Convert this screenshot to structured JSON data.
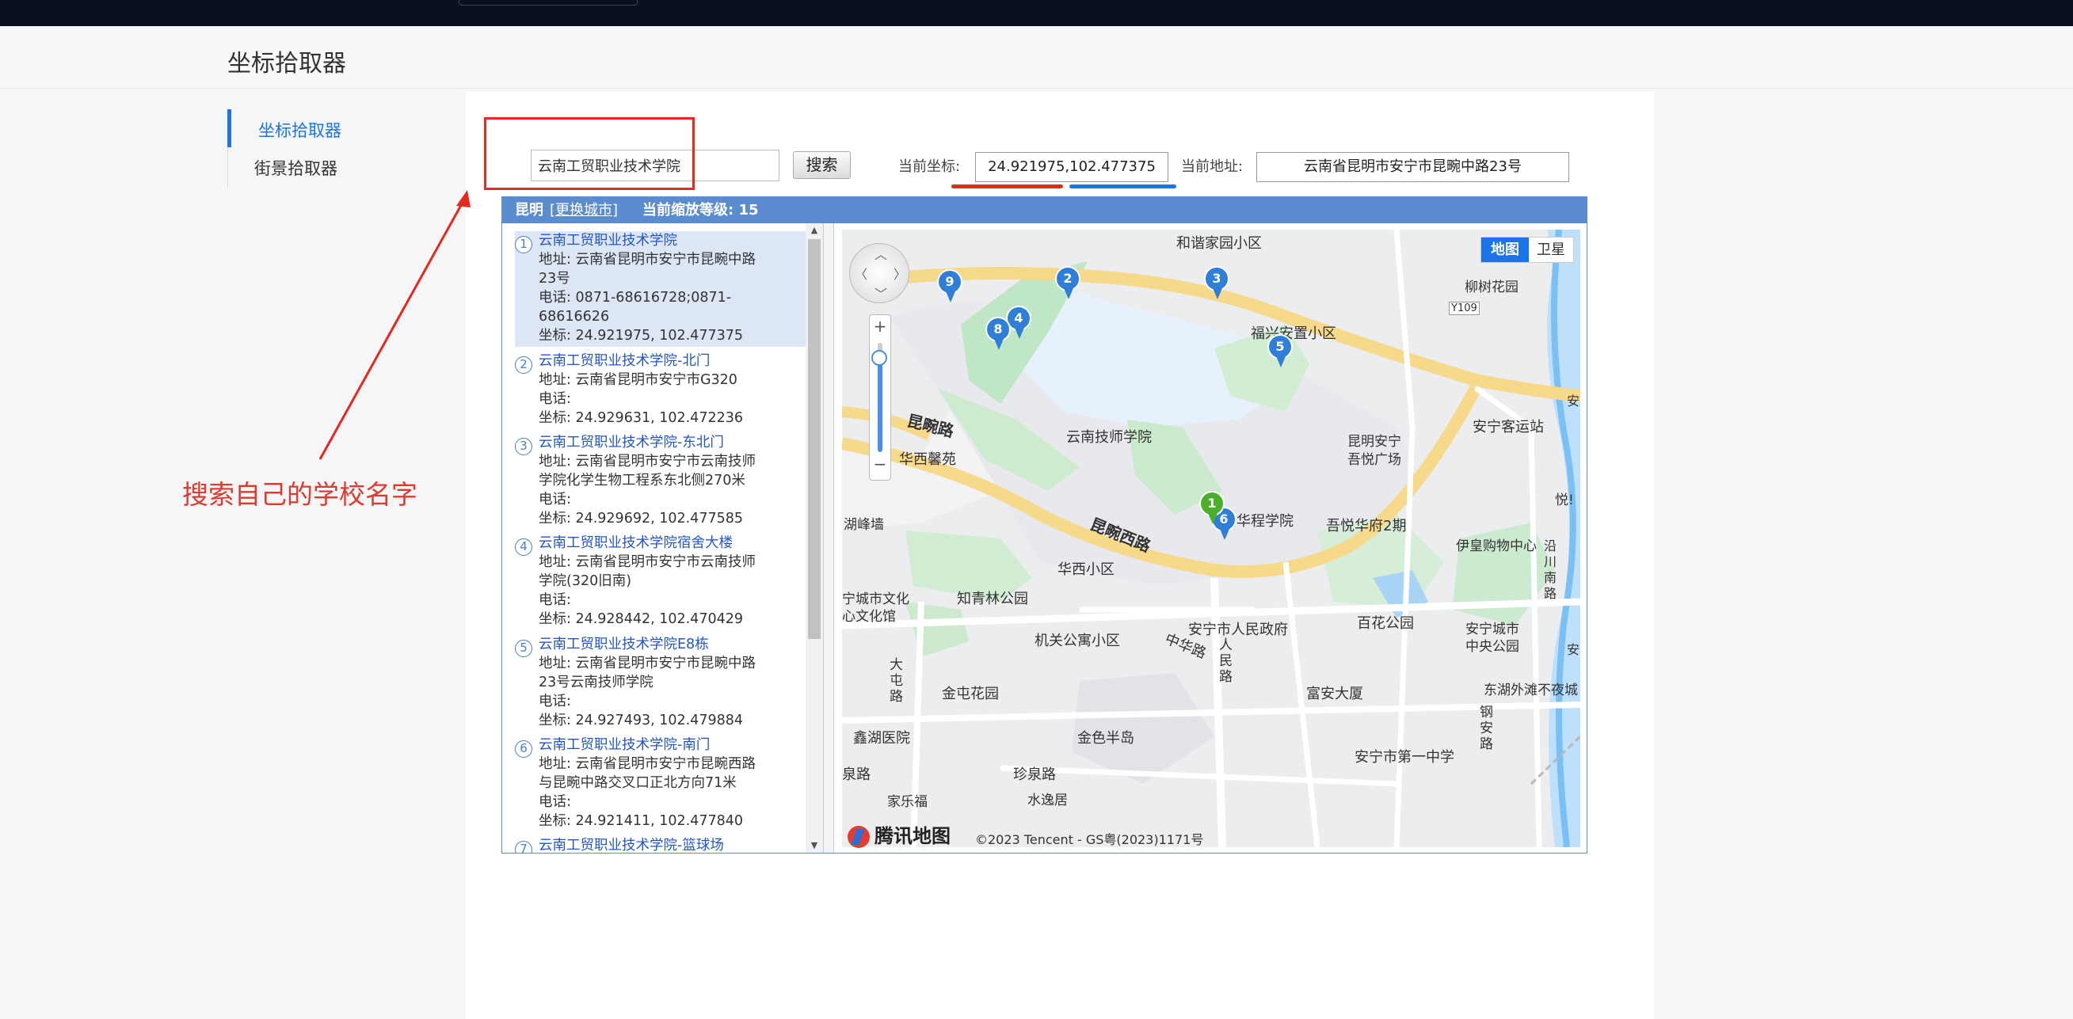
{
  "header": {
    "title": "坐标拾取器"
  },
  "sidebar": {
    "items": [
      {
        "label": "坐标拾取器",
        "active": true
      },
      {
        "label": "街景拾取器",
        "active": false
      }
    ]
  },
  "toolbar": {
    "search_value": "云南工贸职业技术学院",
    "search_button": "搜索",
    "coord_label": "当前坐标:",
    "coord_value": "24.921975,102.477375",
    "address_label": "当前地址:",
    "address_value": "云南省昆明市安宁市昆畹中路23号"
  },
  "panel": {
    "city": "昆明",
    "switch_city": "[更换城市]",
    "zoom_text": "当前缩放等级: 15"
  },
  "results": [
    {
      "num": "1",
      "name": "云南工贸职业技术学院",
      "lines": [
        "地址: 云南省昆明市安宁市昆畹中路",
        "23号",
        "电话: 0871-68616728;0871-",
        "68616626",
        "坐标: 24.921975, 102.477375"
      ]
    },
    {
      "num": "2",
      "name": "云南工贸职业技术学院-北门",
      "lines": [
        "地址: 云南省昆明市安宁市G320",
        "电话:",
        "坐标: 24.929631, 102.472236"
      ]
    },
    {
      "num": "3",
      "name": "云南工贸职业技术学院-东北门",
      "lines": [
        "地址: 云南省昆明市安宁市云南技师",
        "学院化学生物工程系东北侧270米",
        "电话:",
        "坐标: 24.929692, 102.477585"
      ]
    },
    {
      "num": "4",
      "name": "云南工贸职业技术学院宿舍大楼",
      "lines": [
        "地址: 云南省昆明市安宁市云南技师",
        "学院(320旧南)",
        "电话:",
        "坐标: 24.928442, 102.470429"
      ]
    },
    {
      "num": "5",
      "name": "云南工贸职业技术学院E8栋",
      "lines": [
        "地址: 云南省昆明市安宁市昆畹中路",
        "23号云南技师学院",
        "电话:",
        "坐标: 24.927493, 102.479884"
      ]
    },
    {
      "num": "6",
      "name": "云南工贸职业技术学院-南门",
      "lines": [
        "地址: 云南省昆明市安宁市昆畹西路",
        "与昆畹中路交叉口正北方向71米",
        "电话:",
        "坐标: 24.921411, 102.477840"
      ]
    },
    {
      "num": "7",
      "name": "云南工贸职业技术学院-篮球场",
      "lines": []
    }
  ],
  "map": {
    "type_map": "地图",
    "type_satellite": "卫星",
    "logo": "腾讯地图",
    "copyright": "©2023 Tencent - GS粤(2023)1171号",
    "labels": [
      "和谐家园小区",
      "柳树花园",
      "Y109",
      "福兴安置小区",
      "安宁客运站",
      "安",
      "昆畹路",
      "华西馨苑",
      "云南技师学院",
      "昆明安宁",
      "吾悦广场",
      "湖峰墙",
      "南华程学院",
      "吾悦华府2期",
      "伊皇购物中心",
      "悦!",
      "沿川南路",
      "昆畹西路",
      "华西小区",
      "宁城市文化",
      "心文化馆",
      "知青林公园",
      "安宁市人民政府",
      "百花公园",
      "安宁城市",
      "中央公园",
      "安",
      "机关公寓小区",
      "中华路",
      "人民路",
      "大屯路",
      "金屯花园",
      "富安大厦",
      "东湖外滩不夜城",
      "钢安路",
      "鑫湖医院",
      "金色半岛",
      "安宁市第一中学",
      "珍泉路",
      "泉路",
      "家乐福",
      "水逸居"
    ],
    "markers": [
      "9",
      "2",
      "3",
      "4",
      "8",
      "5",
      "1",
      "6"
    ]
  },
  "annotation": {
    "text": "搜索自己的学校名字"
  },
  "colors": {
    "accent": "#1a73e8",
    "annotation": "#e8271d",
    "panel_head": "#5b8ccf",
    "marker": "#2f7fd8",
    "marker_selected": "#4caf2a"
  }
}
